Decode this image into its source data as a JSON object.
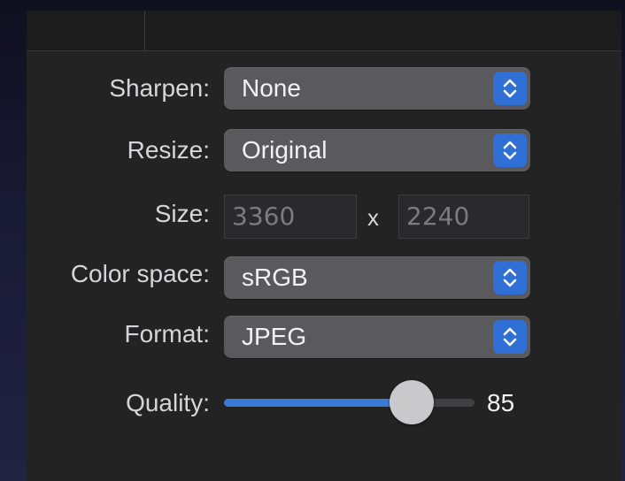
{
  "panel": {
    "sharpen": {
      "label": "Sharpen:",
      "value": "None"
    },
    "resize": {
      "label": "Resize:",
      "value": "Original"
    },
    "size": {
      "label": "Size:",
      "width": "3360",
      "separator": "x",
      "height": "2240"
    },
    "color_space": {
      "label": "Color space:",
      "value": "sRGB"
    },
    "format": {
      "label": "Format:",
      "value": "JPEG"
    },
    "quality": {
      "label": "Quality:",
      "value": "85",
      "fraction": 0.75
    }
  },
  "icons": {
    "stepper": "up-down-chevron-icon"
  },
  "colors": {
    "accent": "#3a7ad7",
    "panel_bg": "#232324",
    "popup_bg": "#5a5a5e"
  }
}
